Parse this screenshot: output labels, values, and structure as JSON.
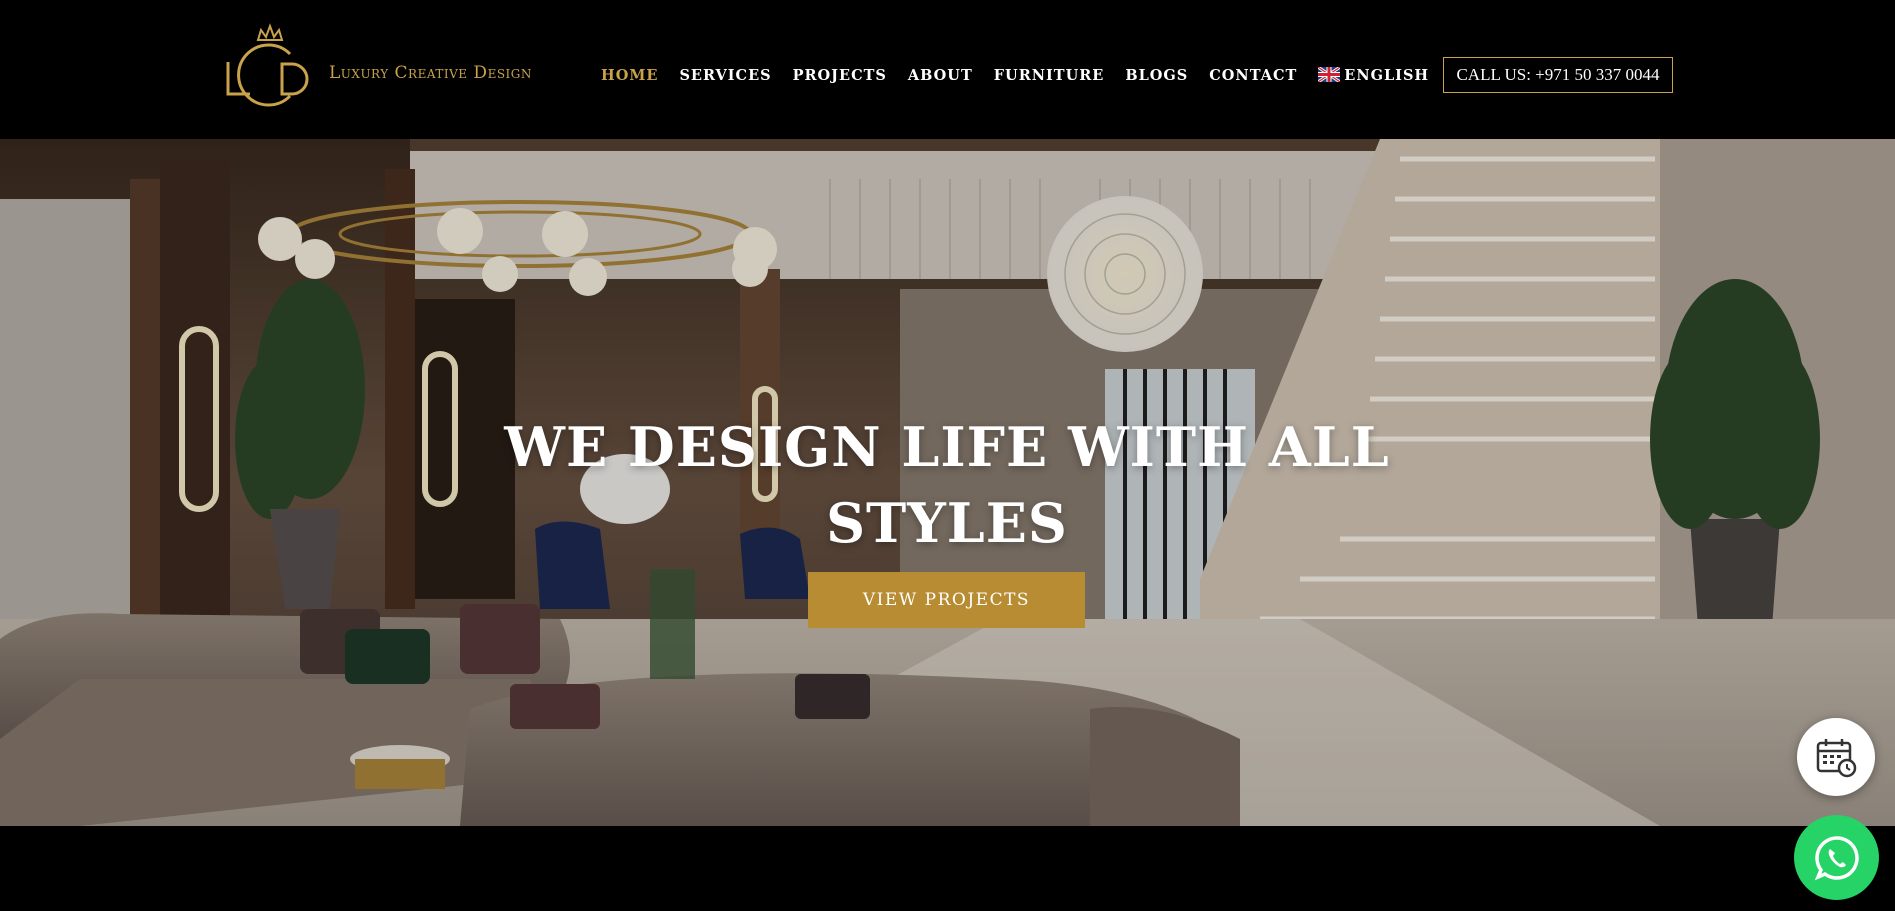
{
  "brand": {
    "logo_icon": "lcd-crown-logo-icon",
    "name": "Luxury Creative Design",
    "color": "#c9a24a"
  },
  "nav": {
    "items": [
      {
        "label": "HOME",
        "active": true
      },
      {
        "label": "SERVICES",
        "active": false
      },
      {
        "label": "PROJECTS",
        "active": false
      },
      {
        "label": "ABOUT",
        "active": false
      },
      {
        "label": "FURNITURE",
        "active": false
      },
      {
        "label": "BLOGS",
        "active": false
      },
      {
        "label": "CONTACT",
        "active": false
      }
    ],
    "language": {
      "label": "ENGLISH",
      "icon": "uk-flag-icon"
    }
  },
  "call": {
    "label": "CALL US: +971 50 337 0044",
    "border_color": "#c9a24a"
  },
  "hero": {
    "title_line1": "WE DESIGN LIFE WITH ALL",
    "title_line2": "STYLES",
    "button_label": "VIEW PROJECTS",
    "button_color": "#b88c32"
  },
  "floating": {
    "calendar_icon": "calendar-clock-icon",
    "whatsapp_icon": "whatsapp-icon",
    "whatsapp_color": "#25d366"
  }
}
